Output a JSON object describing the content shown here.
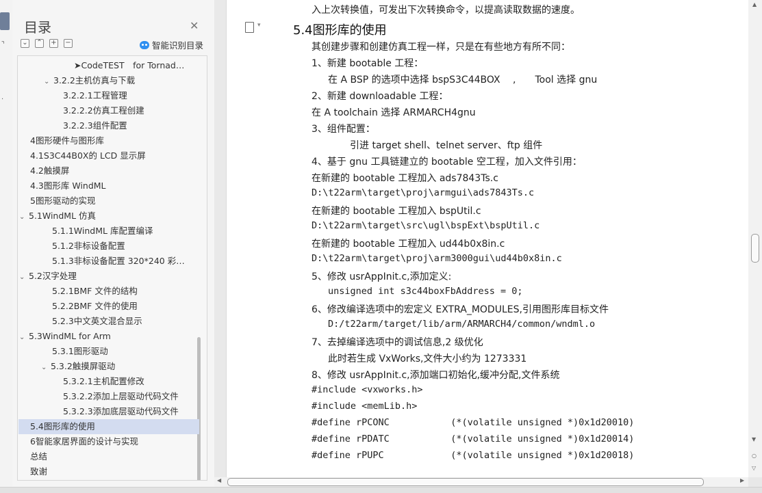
{
  "nav": {
    "title": "目录",
    "smart_label": "智能识别目录",
    "items": [
      {
        "label": "➤CodeTEST　for Tornad…",
        "caret": ""
      },
      {
        "label": "3.2.2主机仿真与下载",
        "caret": "⌄"
      },
      {
        "label": "3.2.2.1工程管理",
        "caret": ""
      },
      {
        "label": "3.2.2.2仿真工程创建",
        "caret": ""
      },
      {
        "label": "3.2.2.3组件配置",
        "caret": ""
      },
      {
        "label": "4图形硬件与图形库",
        "caret": ""
      },
      {
        "label": "4.1S3C44B0X的 LCD 显示屏",
        "caret": ""
      },
      {
        "label": "4.2触摸屏",
        "caret": ""
      },
      {
        "label": "4.3图形库 WindML",
        "caret": ""
      },
      {
        "label": "5图形驱动的实现",
        "caret": ""
      },
      {
        "label": "5.1WindML 仿真",
        "caret": "⌄"
      },
      {
        "label": "5.1.1WindML 库配置编译",
        "caret": ""
      },
      {
        "label": "5.1.2非标设备配置",
        "caret": ""
      },
      {
        "label": "5.1.3非标设备配置 320*240 彩…",
        "caret": ""
      },
      {
        "label": "5.2汉字处理",
        "caret": "⌄"
      },
      {
        "label": "5.2.1BMF 文件的结构",
        "caret": ""
      },
      {
        "label": "5.2.2BMF 文件的使用",
        "caret": ""
      },
      {
        "label": "5.2.3中文英文混合显示",
        "caret": ""
      },
      {
        "label": "5.3WindML for Arm",
        "caret": "⌄"
      },
      {
        "label": "5.3.1图形驱动",
        "caret": ""
      },
      {
        "label": "5.3.2触摸屏驱动",
        "caret": "⌄"
      },
      {
        "label": "5.3.2.1主机配置修改",
        "caret": ""
      },
      {
        "label": "5.3.2.2添加上层驱动代码文件",
        "caret": ""
      },
      {
        "label": "5.3.2.3添加底层驱动代码文件",
        "caret": ""
      },
      {
        "label": "5.4图形库的使用",
        "caret": ""
      },
      {
        "label": "6智能家居界面的设计与实现",
        "caret": ""
      },
      {
        "label": "总结",
        "caret": ""
      },
      {
        "label": "致谢",
        "caret": ""
      }
    ]
  },
  "doc": {
    "top_cut": "入上次转换值，可发出下次转换命令，以提高读取数据的速度。",
    "heading": "5.4图形库的使用",
    "lines": [
      "其创建步骤和创建仿真工程一样，只是在有些地方有所不同：",
      "1、新建 bootable 工程：",
      "在 A BSP 的选项中选择 bspS3C44BOX　 ,　　Tool 选择 gnu",
      "2、新建 downloadable 工程：",
      "在 A toolchain 选择 ARMARCH4gnu",
      "3、组件配置：",
      "引进 target shell、telnet server、ftp 组件",
      "4、基于 gnu 工具链建立的 bootable 空工程，加入文件引用：",
      "在新建的 bootable 工程加入 ads7843Ts.c",
      "D:\\t22arm\\target\\proj\\armgui\\ads7843Ts.c",
      "在新建的 bootable 工程加入 bspUtil.c",
      "D:\\t22arm\\target\\src\\ugl\\bspExt\\bspUtil.c",
      "在新建的 bootable 工程加入 ud44b0x8in.c",
      "D:\\t22arm\\target\\proj\\arm3000gui\\ud44b0x8in.c",
      "5、修改 usrAppInit.c,添加定义:",
      "unsigned int s3c44boxFbAddress = 0;",
      "6、修改编译选项中的宏定义 EXTRA_MODULES,引用图形库目标文件",
      "D:/t22arm/target/lib/arm/ARMARCH4/common/wndml.o",
      "7、去掉编译选项中的调试信息,2 级优化",
      "此时若生成 VxWorks,文件大小约为 1273331",
      "8、修改 usrAppInit.c,添加端口初始化,缓冲分配,文件系统",
      "#include <vxworks.h>",
      "#include <memLib.h>",
      "#define rPCONC           (*(volatile unsigned *)0x1d20010)",
      "#define rPDATC           (*(volatile unsigned *)0x1d20014)",
      "#define rPUPC            (*(volatile unsigned *)0x1d20018)"
    ]
  }
}
